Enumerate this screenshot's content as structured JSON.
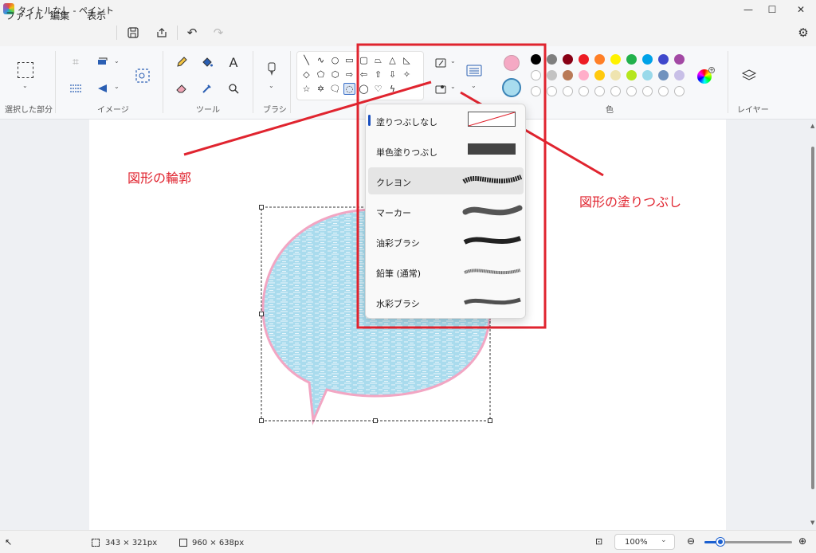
{
  "window": {
    "title": "タイトルなし - ペイント"
  },
  "menu": {
    "items": [
      "ファイル",
      "編集",
      "表示"
    ]
  },
  "ribbon": {
    "groups": {
      "selection": "選択した部分",
      "image": "イメージ",
      "tools": "ツール",
      "brush": "ブラシ",
      "color": "色",
      "layers": "レイヤー"
    },
    "text_tool": "A"
  },
  "colors": {
    "primary": "#f5a9c4",
    "secondary": "#a8dcee",
    "palette_row1": [
      "#000000",
      "#7f7f7f",
      "#880015",
      "#ed1c24",
      "#ff7f27",
      "#fff200",
      "#22b14c",
      "#00a2e8",
      "#3f48cc",
      "#a349a4"
    ],
    "palette_row2": [
      "#ffffff",
      "#c3c3c3",
      "#b97a57",
      "#ffaec9",
      "#ffc90e",
      "#efe4b0",
      "#b5e61d",
      "#99d9ea",
      "#7092be",
      "#c8bfe7"
    ]
  },
  "fill_menu": {
    "items": [
      {
        "label": "塗りつぶしなし"
      },
      {
        "label": "単色塗りつぶし"
      },
      {
        "label": "クレヨン"
      },
      {
        "label": "マーカー"
      },
      {
        "label": "油彩ブラシ"
      },
      {
        "label": "鉛筆 (通常)"
      },
      {
        "label": "水彩ブラシ"
      }
    ]
  },
  "annotations": {
    "outline": "図形の輪郭",
    "fill": "図形の塗りつぶし"
  },
  "status": {
    "selection_size": "343 × 321px",
    "canvas_size": "960 × 638px",
    "zoom": "100%"
  },
  "icons": [
    "select-icon",
    "crop-icon",
    "rotate-icon",
    "resize-icon",
    "flip-icon",
    "image-search-icon",
    "pencil-icon",
    "fill-bucket-icon",
    "text-icon",
    "eraser-icon",
    "color-picker-icon",
    "magnifier-icon",
    "brush-icon",
    "outline-icon",
    "fill-icon",
    "stroke-size-icon",
    "color-editor-icon",
    "layers-icon",
    "settings-icon",
    "save-icon",
    "share-icon",
    "undo-icon",
    "redo-icon"
  ]
}
